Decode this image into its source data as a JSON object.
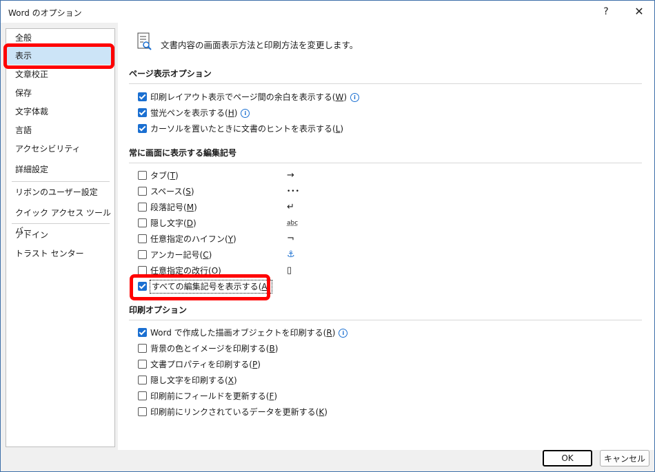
{
  "window": {
    "title": "Word のオプション",
    "help": "?",
    "close": "✕"
  },
  "sidebar": {
    "items": [
      {
        "label": "全般"
      },
      {
        "label": "表示"
      },
      {
        "label": "文章校正"
      },
      {
        "label": "保存"
      },
      {
        "label": "文字体裁"
      },
      {
        "label": "言語"
      },
      {
        "label": "アクセシビリティ"
      },
      {
        "label": "詳細設定"
      },
      {
        "label": "リボンのユーザー設定"
      },
      {
        "label": "クイック アクセス ツール バー"
      },
      {
        "label": "アドイン"
      },
      {
        "label": "トラスト センター"
      }
    ],
    "selected": "表示"
  },
  "intro": {
    "text": "文書内容の画面表示方法と印刷方法を変更します。"
  },
  "page_display": {
    "title": "ページ表示オプション",
    "options": [
      {
        "label": "印刷レイアウト表示でページ間の余白を表示する",
        "key": "W",
        "checked": true,
        "info": true
      },
      {
        "label": "蛍光ペンを表示する",
        "key": "H",
        "checked": true,
        "info": true
      },
      {
        "label": "カーソルを置いたときに文書のヒントを表示する",
        "key": "L",
        "checked": true,
        "info": false
      }
    ]
  },
  "format_marks": {
    "title": "常に画面に表示する編集記号",
    "options": [
      {
        "label": "タブ",
        "key": "T",
        "checked": false,
        "symbol": "→"
      },
      {
        "label": "スペース",
        "key": "S",
        "checked": false,
        "symbol": "•••"
      },
      {
        "label": "段落記号",
        "key": "M",
        "checked": false,
        "symbol": "↵"
      },
      {
        "label": "隠し文字",
        "key": "D",
        "checked": false,
        "symbol": "abc"
      },
      {
        "label": "任意指定のハイフン",
        "key": "Y",
        "checked": false,
        "symbol": "¬"
      },
      {
        "label": "アンカー記号",
        "key": "C",
        "checked": false,
        "symbol": "⚓"
      },
      {
        "label": "任意指定の改行",
        "key": "O",
        "checked": false,
        "symbol": "▯"
      },
      {
        "label": "すべての編集記号を表示する",
        "key": "A",
        "checked": true
      }
    ]
  },
  "print_options": {
    "title": "印刷オプション",
    "options": [
      {
        "label": "Word で作成した描画オブジェクトを印刷する",
        "key": "R",
        "checked": true,
        "info": true
      },
      {
        "label": "背景の色とイメージを印刷する",
        "key": "B",
        "checked": false
      },
      {
        "label": "文書プロパティを印刷する",
        "key": "P",
        "checked": false
      },
      {
        "label": "隠し文字を印刷する",
        "key": "X",
        "checked": false
      },
      {
        "label": "印刷前にフィールドを更新する",
        "key": "F",
        "checked": false
      },
      {
        "label": "印刷前にリンクされているデータを更新する",
        "key": "K",
        "checked": false
      }
    ]
  },
  "buttons": {
    "ok": "OK",
    "cancel": "キャンセル"
  },
  "colors": {
    "accent": "#1a6fd1",
    "highlight": "#ff0000",
    "selected_bg": "#cce4f7"
  }
}
